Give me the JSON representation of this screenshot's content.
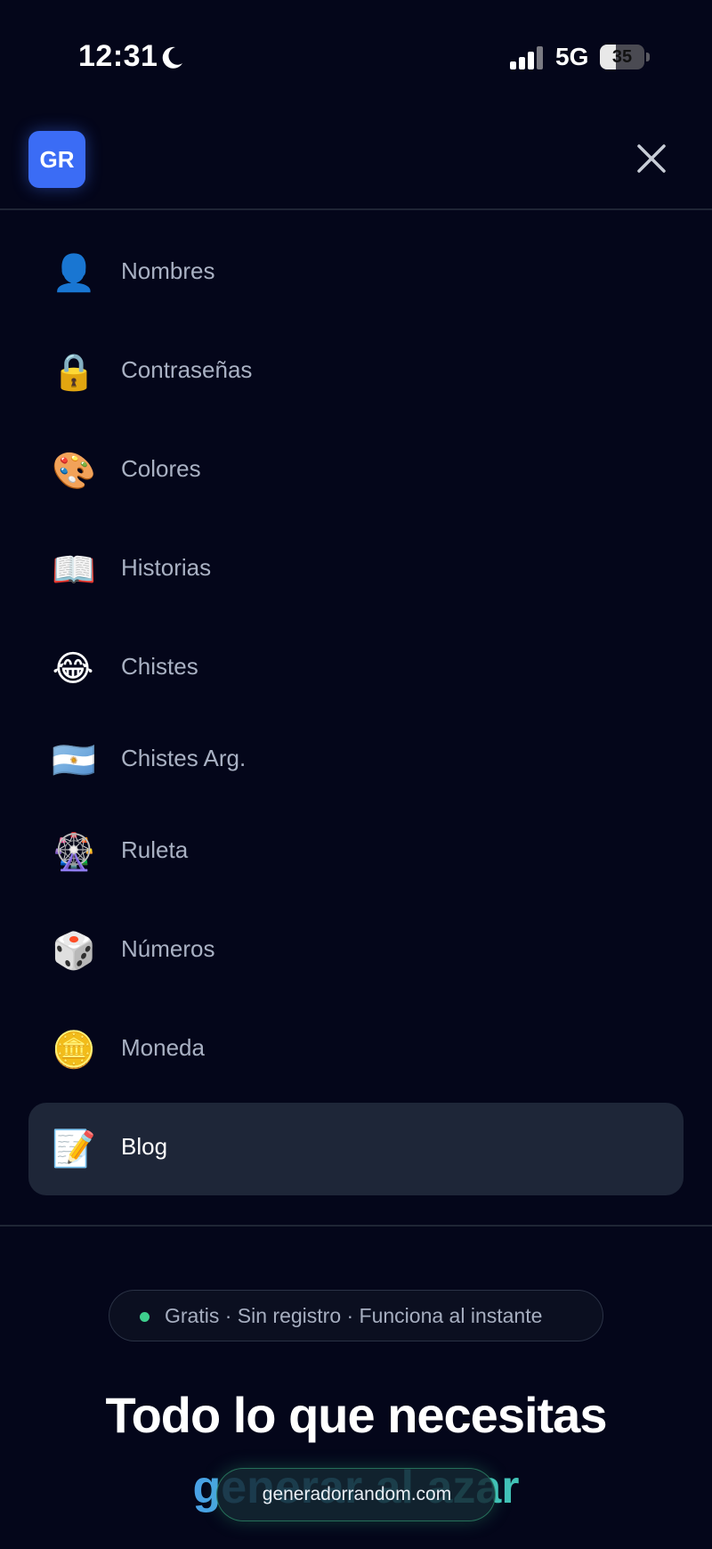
{
  "status_bar": {
    "time": "12:31",
    "network": "5G",
    "battery_level": "35",
    "battery_percent": 35
  },
  "header": {
    "logo_text": "GR"
  },
  "nav": {
    "items": [
      {
        "icon": "👤",
        "icon_name": "person-icon",
        "label": "Nombres",
        "active": false
      },
      {
        "icon": "🔒",
        "icon_name": "lock-icon",
        "label": "Contraseñas",
        "active": false
      },
      {
        "icon": "🎨",
        "icon_name": "palette-icon",
        "label": "Colores",
        "active": false
      },
      {
        "icon": "📖",
        "icon_name": "book-icon",
        "label": "Historias",
        "active": false
      },
      {
        "icon": "😂",
        "icon_name": "laughing-face-icon",
        "label": "Chistes",
        "active": false
      },
      {
        "icon": "🇦🇷",
        "icon_name": "argentina-flag-icon",
        "label": "Chistes Arg.",
        "active": false
      },
      {
        "icon": "🎡",
        "icon_name": "ferris-wheel-icon",
        "label": "Ruleta",
        "active": false
      },
      {
        "icon": "🎲",
        "icon_name": "dice-icon",
        "label": "Números",
        "active": false
      },
      {
        "icon": "🪙",
        "icon_name": "coin-icon",
        "label": "Moneda",
        "active": false
      },
      {
        "icon": "📝",
        "icon_name": "memo-icon",
        "label": "Blog",
        "active": true
      }
    ]
  },
  "badge": {
    "text": "Gratis · Sin registro · Funciona al instante",
    "dot_color": "#3ecf8e"
  },
  "hero": {
    "title": "Todo lo que necesitas",
    "subtitle": "generar al azar"
  },
  "browser": {
    "url": "generadorrandom.com"
  },
  "colors": {
    "background": "#04061a",
    "accent": "#3b6cf5",
    "active_item": "#1e2638",
    "muted_text": "#a9b1c3"
  }
}
